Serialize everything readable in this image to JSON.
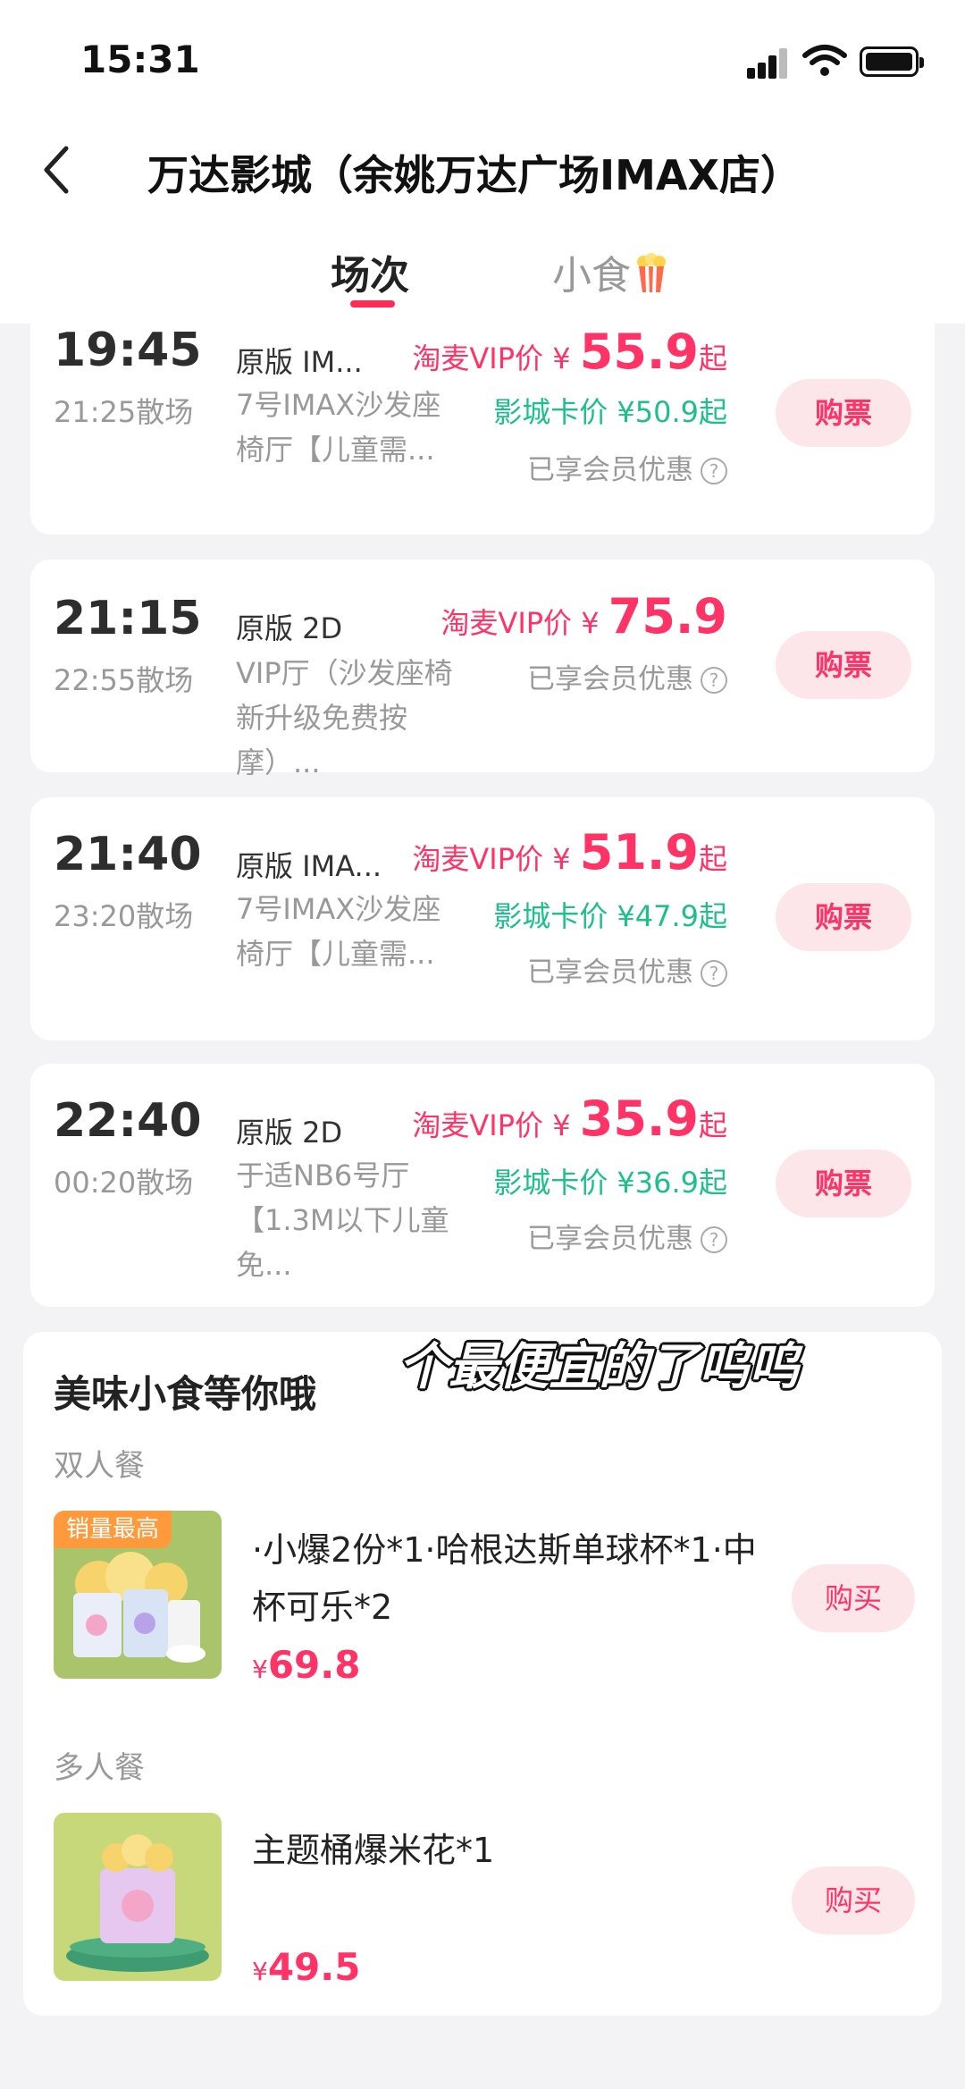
{
  "status_bar": {
    "time": "15:31"
  },
  "header": {
    "title": "万达影城（余姚万达广场IMAX店）",
    "tabs": [
      {
        "label": "场次",
        "active": true
      },
      {
        "label": "小食",
        "active": false
      }
    ]
  },
  "sessions": [
    {
      "start": "19:45",
      "end": "21:25散场",
      "version": "原版 IM...",
      "hall": "7号IMAX沙发座椅厅【儿童需...",
      "vip_label": "淘麦VIP价 ¥",
      "vip_price": "55.9",
      "vip_suffix": "起",
      "card_price": "影城卡价 ¥50.9起",
      "member": "已享会员优惠",
      "buy": "购票"
    },
    {
      "start": "21:15",
      "end": "22:55散场",
      "version": "原版 2D",
      "hall": "VIP厅（沙发座椅新升级免费按摩）...",
      "vip_label": "淘麦VIP价 ¥",
      "vip_price": "75.9",
      "vip_suffix": "",
      "member": "已享会员优惠",
      "buy": "购票"
    },
    {
      "start": "21:40",
      "end": "23:20散场",
      "version": "原版 IMA...",
      "hall": "7号IMAX沙发座椅厅【儿童需...",
      "vip_label": "淘麦VIP价 ¥",
      "vip_price": "51.9",
      "vip_suffix": "起",
      "card_price": "影城卡价 ¥47.9起",
      "member": "已享会员优惠",
      "buy": "购票"
    },
    {
      "start": "22:40",
      "end": "00:20散场",
      "version": "原版 2D",
      "hall": "于适NB6号厅【1.3M以下儿童免...",
      "vip_label": "淘麦VIP价 ¥",
      "vip_price": "35.9",
      "vip_suffix": "起",
      "card_price": "影城卡价 ¥36.9起",
      "member": "已享会员优惠",
      "buy": "购票"
    }
  ],
  "food": {
    "title": "美味小食等你哦",
    "overlay_caption": "个最便宜的了呜呜",
    "packages": [
      {
        "category": "双人餐",
        "badge": "销量最高",
        "desc": "·小爆2份*1·哈根达斯单球杯*1·中杯可乐*2",
        "currency": "¥",
        "price": "69.8",
        "buy": "购买"
      },
      {
        "category": "多人餐",
        "desc": "主题桶爆米花*1",
        "currency": "¥",
        "price": "49.5",
        "buy": "购买"
      }
    ]
  },
  "colors": {
    "accent": "#ff3366",
    "card_price_green": "#1dbf8b",
    "button_bg": "#fde6ea"
  }
}
